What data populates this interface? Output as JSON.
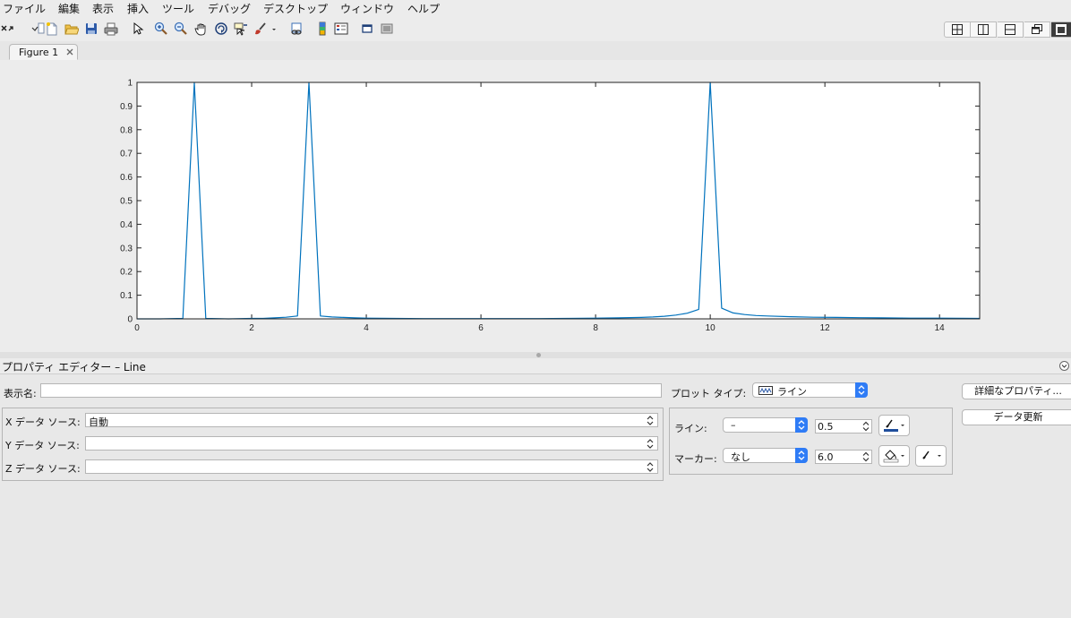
{
  "menu": [
    "ファイル",
    "編集",
    "表示",
    "挿入",
    "ツール",
    "デバッグ",
    "デスクトップ",
    "ウィンドウ",
    "ヘルプ"
  ],
  "toolbar": {
    "icons": [
      "close-undock-icon",
      "new-figure-icon",
      "open-file-icon",
      "save-icon",
      "print-icon",
      "select-arrow-icon",
      "zoom-in-icon",
      "zoom-out-icon",
      "pan-hand-icon",
      "rotate-3d-icon",
      "data-cursor-icon",
      "brush-icon",
      "link-plot-icon",
      "colorbar-icon",
      "legend-icon",
      "hide-plot-tools-icon",
      "show-plot-tools-icon"
    ],
    "layout_buttons": [
      "tile-grid-icon",
      "split-vertical-icon",
      "split-horizontal-icon",
      "float-window-icon",
      "maximize-icon"
    ]
  },
  "tabs": {
    "figure_tab": "Figure 1"
  },
  "chart_data": {
    "type": "line",
    "title": "",
    "xlabel": "",
    "ylabel": "",
    "xlim": [
      0,
      14.7
    ],
    "ylim": [
      0,
      1
    ],
    "xticks": [
      0,
      2,
      4,
      6,
      8,
      10,
      12,
      14
    ],
    "yticks": [
      0,
      0.1,
      0.2,
      0.3,
      0.4,
      0.5,
      0.6,
      0.7,
      0.8,
      0.9,
      1
    ],
    "ytick_labels": [
      "0",
      "0.1",
      "0.2",
      "0.3",
      "0.4",
      "0.5",
      "0.6",
      "0.7",
      "0.8",
      "0.9",
      "1"
    ],
    "xtick_labels": [
      "0",
      "2",
      "4",
      "6",
      "8",
      "10",
      "12",
      "14"
    ],
    "grid": false,
    "color": "#0072bd",
    "series": [
      {
        "x": [
          0,
          0.2,
          0.4,
          0.6,
          0.8,
          1.0,
          1.2,
          1.4,
          1.6,
          1.8,
          2.0,
          2.2,
          2.4,
          2.6,
          2.8,
          3.0,
          3.2,
          3.4,
          3.6,
          3.8,
          4.0,
          4.5,
          5.0,
          5.5,
          6.0,
          6.5,
          7.0,
          7.5,
          8.0,
          8.4,
          8.8,
          9.0,
          9.2,
          9.4,
          9.6,
          9.8,
          10.0,
          10.2,
          10.4,
          10.6,
          10.8,
          11.0,
          11.4,
          11.8,
          12.2,
          12.6,
          13.0,
          13.5,
          14.0,
          14.7
        ],
        "y": [
          0,
          0,
          0,
          0.001,
          0.002,
          1,
          0.002,
          0.001,
          0,
          0.001,
          0.002,
          0.002,
          0.004,
          0.007,
          0.012,
          1,
          0.012,
          0.008,
          0.006,
          0.004,
          0.003,
          0.002,
          0.001,
          0.001,
          0.001,
          0.001,
          0.001,
          0.002,
          0.003,
          0.004,
          0.006,
          0.008,
          0.011,
          0.016,
          0.024,
          0.04,
          1,
          0.045,
          0.025,
          0.018,
          0.014,
          0.012,
          0.009,
          0.007,
          0.006,
          0.005,
          0.004,
          0.003,
          0.003,
          0.002
        ]
      }
    ]
  },
  "property_editor": {
    "title": "プロパティ エディター – Line",
    "display_name_label": "表示名:",
    "display_name_value": "",
    "plot_type_label": "プロット タイプ:",
    "plot_type_value": "ライン",
    "advanced_button": "詳細なプロパティ...",
    "refresh_button": "データ更新",
    "x_source_label": "X データ ソース:",
    "x_source_value": "自動",
    "y_source_label": "Y データ ソース:",
    "y_source_value": "",
    "z_source_label": "Z データ ソース:",
    "z_source_value": "",
    "line_label": "ライン:",
    "line_style_value": "–",
    "line_width_value": "0.5",
    "marker_label": "マーカー:",
    "marker_value": "なし",
    "marker_size_value": "6.0",
    "line_color": "#1f4e9c"
  }
}
